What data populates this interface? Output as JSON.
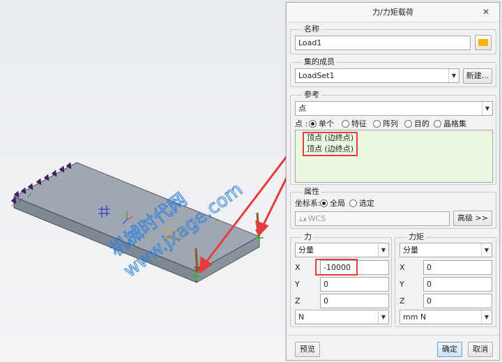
{
  "dialog": {
    "title": "力/力矩载荷",
    "name_group": {
      "title": "名称",
      "value": "Load1"
    },
    "members_group": {
      "title": "集的成员",
      "value": "LoadSet1",
      "new_button": "新建..."
    },
    "references_group": {
      "title": "参考",
      "type_value": "点",
      "point_label": "点 :",
      "radio_options": [
        {
          "label": "单个",
          "selected": true
        },
        {
          "label": "特征",
          "selected": false
        },
        {
          "label": "阵列",
          "selected": false
        },
        {
          "label": "目的",
          "selected": false
        },
        {
          "label": "晶格集",
          "selected": false
        }
      ],
      "items": [
        "顶点 (边终点)",
        "顶点 (边终点)"
      ]
    },
    "properties_group": {
      "title": "属性",
      "csys_label": "坐标系:",
      "csys_options": [
        {
          "label": "全局",
          "selected": true
        },
        {
          "label": "选定",
          "selected": false
        }
      ],
      "csys_placeholder": "WCS",
      "advanced_button": "高级 >>"
    },
    "force_group": {
      "title": "力",
      "mode": "分量",
      "x_label": "X",
      "x_value": "-10000",
      "y_label": "Y",
      "y_value": "0",
      "z_label": "Z",
      "z_value": "0",
      "unit": "N"
    },
    "moment_group": {
      "title": "力矩",
      "mode": "分量",
      "x_label": "X",
      "x_value": "0",
      "y_label": "Y",
      "y_value": "0",
      "z_label": "Z",
      "z_value": "0",
      "unit": "mm N"
    },
    "preview_button": "预览",
    "ok_button": "确定",
    "cancel_button": "取消"
  },
  "viewport": {
    "watermark_cn": "机械时代网",
    "watermark_url": "www.jxage.com",
    "part_color": "#9fa8b2",
    "highlight_color": "#e53b3b"
  },
  "icons": [
    "close-icon",
    "color-picker-icon",
    "dropdown-arrow-icon",
    "coordinate-system-icon",
    "constraint-icon",
    "force-arrow-icon"
  ]
}
